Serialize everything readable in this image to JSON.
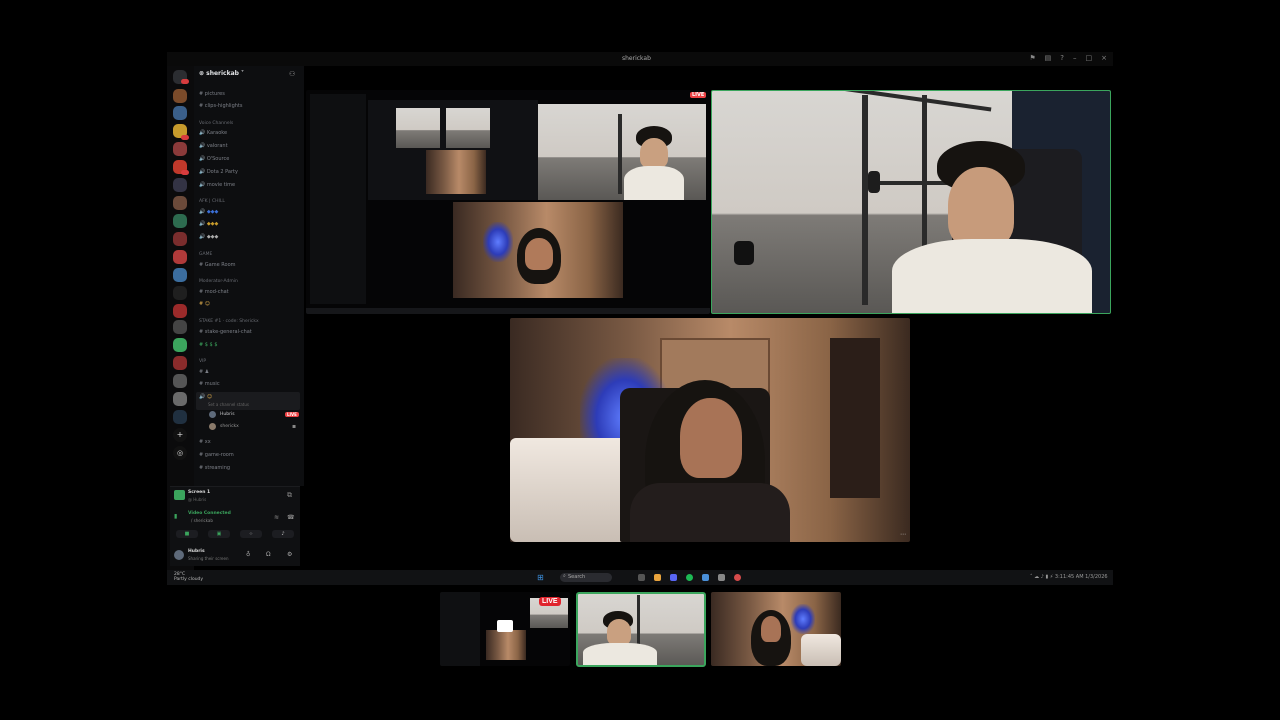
{
  "window": {
    "title": "sherickab"
  },
  "sidebar": {
    "guild_name": "sherickab",
    "channels_top": [
      "pictures",
      "clips-highlights"
    ],
    "voice_category": "Voice Channels",
    "voice_channels": [
      "Karaoke",
      "valorant",
      "O'Source",
      "Dota 2 Party",
      "movie time"
    ],
    "afk_category": "AFK | CHILL",
    "game_category": "GAME",
    "game_channels": [
      "Game Room"
    ],
    "mod_category": "Moderator-Admin",
    "mod_channels": [
      "mod-chat"
    ],
    "stake_category": "STAKE #1 · code: Sherickx",
    "stake_channels": [
      "stake-general-chat"
    ],
    "vip_category": "VIP",
    "misc_channels": [
      "music"
    ],
    "active_voice_status": "Set a channel status",
    "voice_users": [
      {
        "name": "Hubris",
        "live": "LIVE"
      },
      {
        "name": "sherickx"
      }
    ],
    "bottom_channels": [
      "xx",
      "game-room",
      "streaming"
    ]
  },
  "voice_panel": {
    "screen_title": "Screen 1",
    "screen_sub": "@ Hubris",
    "connection_status": "Video Connected",
    "connection_sub": "/ sherickab",
    "user_name": "Hubris",
    "user_status": "Sharing their screen"
  },
  "stage": {
    "live_label": "LIVE"
  },
  "taskbar": {
    "weather_temp": "28°C",
    "weather_desc": "Partly cloudy",
    "search_placeholder": "Search",
    "clock": "3:11:45 AM",
    "date": "1/3/2026"
  },
  "thumbnails": {
    "live_label": "LIVE"
  },
  "colors": {
    "accent_green": "#3ba55d",
    "live_red": "#e0232c"
  }
}
